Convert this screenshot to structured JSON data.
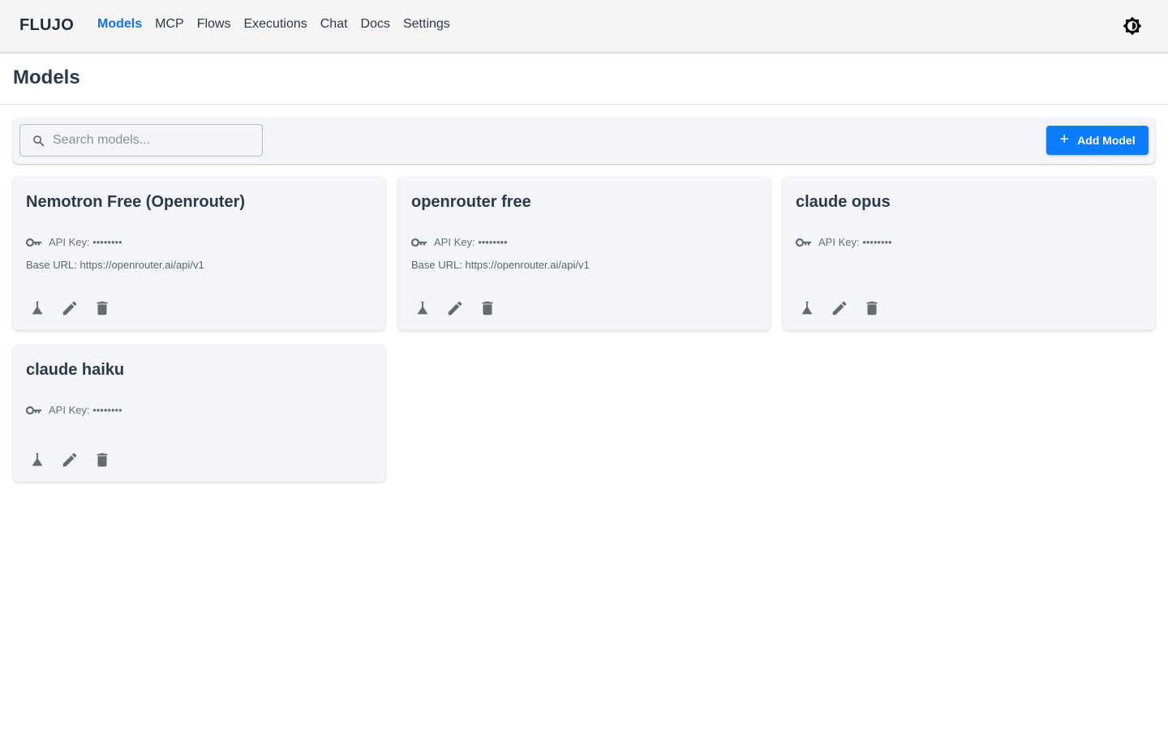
{
  "nav": {
    "brand": "FLUJO",
    "items": [
      "Models",
      "MCP",
      "Flows",
      "Executions",
      "Chat",
      "Docs",
      "Settings"
    ],
    "active": "Models"
  },
  "page": {
    "title": "Models"
  },
  "toolbar": {
    "search_placeholder": "Search models...",
    "add_label": "Add Model"
  },
  "models": [
    {
      "name": "Nemotron Free (Openrouter)",
      "api_key": "API Key: ••••••••",
      "base_url": "Base URL: https://openrouter.ai/api/v1"
    },
    {
      "name": "openrouter free",
      "api_key": "API Key: ••••••••",
      "base_url": "Base URL: https://openrouter.ai/api/v1"
    },
    {
      "name": "claude opus",
      "api_key": "API Key: ••••••••",
      "base_url": ""
    },
    {
      "name": "claude haiku",
      "api_key": "API Key: ••••••••",
      "base_url": ""
    }
  ],
  "icons": {
    "theme": "brightness-icon",
    "search": "search-icon",
    "key": "key-icon",
    "test": "flask-icon",
    "edit": "pencil-icon",
    "delete": "trash-icon"
  },
  "colors": {
    "accent": "#1a73e8",
    "button": "#0a7cff",
    "card_bg": "#f4f5f8"
  }
}
